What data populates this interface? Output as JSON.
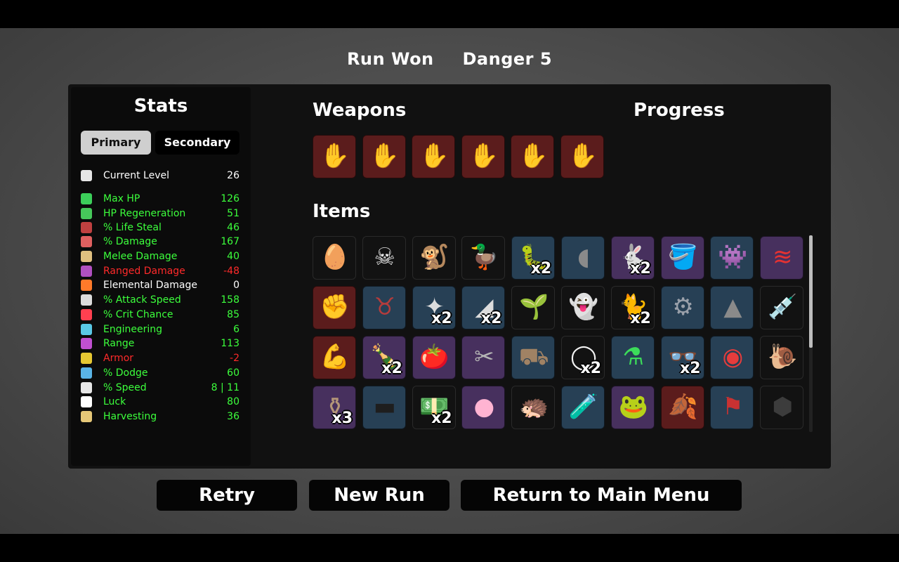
{
  "header": {
    "result": "Run Won",
    "danger": "Danger 5"
  },
  "stats": {
    "title": "Stats",
    "tabs": {
      "primary": "Primary",
      "secondary": "Secondary"
    },
    "rows": [
      {
        "label": "Current Level",
        "value": "26",
        "color": "#ffffff",
        "icon": "level-icon",
        "icon_color": "#e6e6e6"
      },
      {
        "label": "Max HP",
        "value": "126",
        "color": "#3cff3c",
        "icon": "heart-icon",
        "icon_color": "#3ccf5a"
      },
      {
        "label": "HP Regeneration",
        "value": "51",
        "color": "#3cff3c",
        "icon": "hp-regen-icon",
        "icon_color": "#46c85a"
      },
      {
        "label": "% Life Steal",
        "value": "46",
        "color": "#3cff3c",
        "icon": "life-steal-icon",
        "icon_color": "#c04040"
      },
      {
        "label": "% Damage",
        "value": "167",
        "color": "#3cff3c",
        "icon": "damage-icon",
        "icon_color": "#e06060"
      },
      {
        "label": "Melee Damage",
        "value": "40",
        "color": "#3cff3c",
        "icon": "melee-icon",
        "icon_color": "#e0c080"
      },
      {
        "label": "Ranged Damage",
        "value": "-48",
        "color": "#ff2a2a",
        "icon": "ranged-icon",
        "icon_color": "#b050c0"
      },
      {
        "label": "Elemental Damage",
        "value": "0",
        "color": "#ffffff",
        "icon": "fire-icon",
        "icon_color": "#ff7a2a"
      },
      {
        "label": "% Attack Speed",
        "value": "158",
        "color": "#3cff3c",
        "icon": "hourglass-icon",
        "icon_color": "#dcdcdc"
      },
      {
        "label": "% Crit Chance",
        "value": "85",
        "color": "#3cff3c",
        "icon": "crit-icon",
        "icon_color": "#ff4050"
      },
      {
        "label": "Engineering",
        "value": "6",
        "color": "#3cff3c",
        "icon": "wrench-icon",
        "icon_color": "#5ac8e6"
      },
      {
        "label": "Range",
        "value": "113",
        "color": "#3cff3c",
        "icon": "range-icon",
        "icon_color": "#c050d0"
      },
      {
        "label": "Armor",
        "value": "-2",
        "color": "#ff2a2a",
        "icon": "shield-icon",
        "icon_color": "#e6c832"
      },
      {
        "label": "% Dodge",
        "value": "60",
        "color": "#3cff3c",
        "icon": "dodge-icon",
        "icon_color": "#5ab4e6"
      },
      {
        "label": "% Speed",
        "value": "8 | 11",
        "color": "#3cff3c",
        "icon": "speed-icon",
        "icon_color": "#e6e6e6"
      },
      {
        "label": "Luck",
        "value": "80",
        "color": "#3cff3c",
        "icon": "dice-icon",
        "icon_color": "#ffffff"
      },
      {
        "label": "Harvesting",
        "value": "36",
        "color": "#3cff3c",
        "icon": "wheat-icon",
        "icon_color": "#e6c878"
      }
    ]
  },
  "weapons": {
    "title": "Weapons",
    "slots": [
      {
        "icon": "claw-glove-icon",
        "glyph": "✋",
        "glyph_color": "#f2f2f2",
        "bg": "red"
      },
      {
        "icon": "claw-glove-icon",
        "glyph": "✋",
        "glyph_color": "#f2f2f2",
        "bg": "red"
      },
      {
        "icon": "claw-glove-icon",
        "glyph": "✋",
        "glyph_color": "#f2f2f2",
        "bg": "red"
      },
      {
        "icon": "claw-glove-icon",
        "glyph": "✋",
        "glyph_color": "#f2f2f2",
        "bg": "red"
      },
      {
        "icon": "claw-glove-icon",
        "glyph": "✋",
        "glyph_color": "#f2f2f2",
        "bg": "red"
      },
      {
        "icon": "claw-glove-icon",
        "glyph": "✋",
        "glyph_color": "#f2f2f2",
        "bg": "red"
      }
    ]
  },
  "progress": {
    "title": "Progress"
  },
  "items": {
    "title": "Items",
    "slots": [
      {
        "icon": "egg-icon",
        "glyph": "🥚",
        "glyph_color": "#f2f2f2",
        "bg": "black",
        "qty": ""
      },
      {
        "icon": "animal-skull-icon",
        "glyph": "☠",
        "glyph_color": "#e6e6e6",
        "bg": "black",
        "qty": ""
      },
      {
        "icon": "monkey-icon",
        "glyph": "🐒",
        "glyph_color": "#a07850",
        "bg": "black",
        "qty": ""
      },
      {
        "icon": "rubber-duck-icon",
        "glyph": "🦆",
        "glyph_color": "#ffd21e",
        "bg": "black",
        "qty": ""
      },
      {
        "icon": "cocoon-icon",
        "glyph": "🐛",
        "glyph_color": "#555555",
        "bg": "blue",
        "qty": "x2"
      },
      {
        "icon": "bandage-icon",
        "glyph": "◖",
        "glyph_color": "#8a8a8a",
        "bg": "blue",
        "qty": ""
      },
      {
        "icon": "rabbit-icon",
        "glyph": "🐇",
        "glyph_color": "#e6e6e6",
        "bg": "purple",
        "qty": "x2"
      },
      {
        "icon": "bucket-icon",
        "glyph": "🪣",
        "glyph_color": "#e6e6e6",
        "bg": "purple",
        "qty": ""
      },
      {
        "icon": "alien-blob-icon",
        "glyph": "👾",
        "glyph_color": "#7ac850",
        "bg": "blue",
        "qty": ""
      },
      {
        "icon": "claw-marks-icon",
        "glyph": "≋",
        "glyph_color": "#e63232",
        "bg": "purple",
        "qty": ""
      },
      {
        "icon": "severed-hand-icon",
        "glyph": "✊",
        "glyph_color": "#e6e6e6",
        "bg": "red",
        "qty": ""
      },
      {
        "icon": "horns-icon",
        "glyph": "♉",
        "glyph_color": "#b43c3c",
        "bg": "blue",
        "qty": ""
      },
      {
        "icon": "shards-icon",
        "glyph": "✦",
        "glyph_color": "#dcdcdc",
        "bg": "blue",
        "qty": "x2"
      },
      {
        "icon": "blade-icon",
        "glyph": "◢",
        "glyph_color": "#dcdcdc",
        "bg": "blue",
        "qty": "x2"
      },
      {
        "icon": "sprout-icon",
        "glyph": "🌱",
        "glyph_color": "#5ac85a",
        "bg": "black",
        "qty": ""
      },
      {
        "icon": "ghost-skull-icon",
        "glyph": "👻",
        "glyph_color": "#f0f0f0",
        "bg": "black",
        "qty": ""
      },
      {
        "icon": "cat-icon",
        "glyph": "🐈",
        "glyph_color": "#787878",
        "bg": "black",
        "qty": "x2"
      },
      {
        "icon": "trap-icon",
        "glyph": "⚙",
        "glyph_color": "#9aa0aa",
        "bg": "blue",
        "qty": ""
      },
      {
        "icon": "bullet-icon",
        "glyph": "▲",
        "glyph_color": "#8a8a8a",
        "bg": "blue",
        "qty": ""
      },
      {
        "icon": "syringe-icon",
        "glyph": "💉",
        "glyph_color": "#c864dc",
        "bg": "black",
        "qty": ""
      },
      {
        "icon": "flexed-arm-icon",
        "glyph": "💪",
        "glyph_color": "#f2f2f2",
        "bg": "red",
        "qty": ""
      },
      {
        "icon": "bottle-icon",
        "glyph": "🍾",
        "glyph_color": "#b4d2dc",
        "bg": "purple",
        "qty": "x2"
      },
      {
        "icon": "tomato-icon",
        "glyph": "🍅",
        "glyph_color": "#e63c32",
        "bg": "purple",
        "qty": ""
      },
      {
        "icon": "tongs-icon",
        "glyph": "✂",
        "glyph_color": "#b4b4b4",
        "bg": "purple",
        "qty": ""
      },
      {
        "icon": "wheelbarrow-icon",
        "glyph": "⛟",
        "glyph_color": "#a08264",
        "bg": "blue",
        "qty": ""
      },
      {
        "icon": "bandana-icon",
        "glyph": "◯",
        "glyph_color": "#f2f2f2",
        "bg": "black",
        "qty": "x2"
      },
      {
        "icon": "flask-icon",
        "glyph": "⚗",
        "glyph_color": "#3cdc5a",
        "bg": "blue",
        "qty": ""
      },
      {
        "icon": "glasses-icon",
        "glyph": "👓",
        "glyph_color": "#1e1e1e",
        "bg": "blue",
        "qty": "x2"
      },
      {
        "icon": "donut-icon",
        "glyph": "◉",
        "glyph_color": "#e63c3c",
        "bg": "blue",
        "qty": ""
      },
      {
        "icon": "snail-icon",
        "glyph": "🐌",
        "glyph_color": "#b4a078",
        "bg": "black",
        "qty": ""
      },
      {
        "icon": "mortar-icon",
        "glyph": "⚱",
        "glyph_color": "#b49678",
        "bg": "purple",
        "qty": "x3"
      },
      {
        "icon": "scarf-icon",
        "glyph": "▬",
        "glyph_color": "#1e1e1e",
        "bg": "blue",
        "qty": ""
      },
      {
        "icon": "banknote-icon",
        "glyph": "💵",
        "glyph_color": "#c8b478",
        "bg": "black",
        "qty": "x2"
      },
      {
        "icon": "pink-pill-icon",
        "glyph": "●",
        "glyph_color": "#ffb4d2",
        "bg": "purple",
        "qty": ""
      },
      {
        "icon": "hedgehog-icon",
        "glyph": "🦔",
        "glyph_color": "#a08c78",
        "bg": "black",
        "qty": ""
      },
      {
        "icon": "potion-icon",
        "glyph": "🧪",
        "glyph_color": "#5a7aa0",
        "bg": "blue",
        "qty": ""
      },
      {
        "icon": "frog-icon",
        "glyph": "🐸",
        "glyph_color": "#8cb478",
        "bg": "purple",
        "qty": ""
      },
      {
        "icon": "rainbow-leaf-icon",
        "glyph": "🍂",
        "glyph_color": "#ffaa32",
        "bg": "red",
        "qty": ""
      },
      {
        "icon": "banner-icon",
        "glyph": "⚑",
        "glyph_color": "#c83232",
        "bg": "blue",
        "qty": ""
      },
      {
        "icon": "rock-icon",
        "glyph": "⬢",
        "glyph_color": "#3c3c3c",
        "bg": "black",
        "qty": ""
      }
    ]
  },
  "buttons": {
    "retry": "Retry",
    "new_run": "New Run",
    "main_menu": "Return to Main Menu"
  }
}
